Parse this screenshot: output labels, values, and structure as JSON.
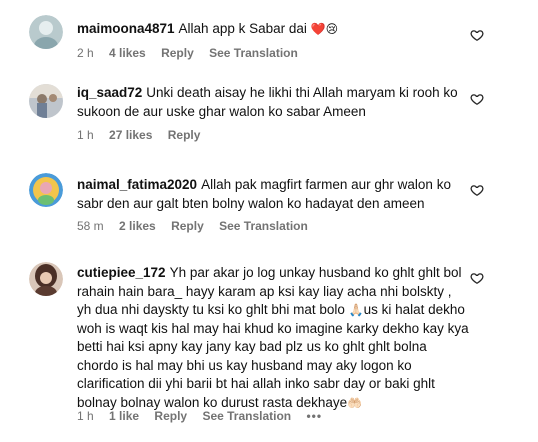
{
  "comments": [
    {
      "username": "maimoona4871",
      "text": "Allah app k Sabar dai",
      "emoji": "❤️😢",
      "time": "2 h",
      "likes": "4 likes",
      "reply": "Reply",
      "see_translation": "See Translation",
      "avatar_colors": [
        "#8aa6ad",
        "#dfe9ea"
      ]
    },
    {
      "username": "iq_saad72",
      "text": "Unki death aisay he likhi thi Allah maryam ki rooh ko sukoon de aur uske ghar walon ko sabar Ameen",
      "time": "1 h",
      "likes": "27 likes",
      "reply": "Reply",
      "avatar_colors": [
        "#c9c2b8",
        "#9a9fa6"
      ]
    },
    {
      "username": "naimal_fatima2020",
      "text": "Allah pak magfirt farmen aur ghr walon ko sabr den aur galt bten bolny walon ko hadayat den ameen",
      "time": "58 m",
      "likes": "2 likes",
      "reply": "Reply",
      "see_translation": "See Translation",
      "avatar_colors": [
        "#3d8fd6",
        "#f1c14d"
      ]
    },
    {
      "username": "cutiepiee_172",
      "text_before_emoji": "Yh par akar jo log unkay husband ko ghlt ghlt bol rahain hain bara_ hayy karam ap ksi kay liay acha nhi bolskty , yh dua nhi dayskty tu ksi ko ghlt bhi mat bolo ",
      "emoji_mid": "🙏🏻",
      "text_after_emoji": "us ki halat dekho woh is waqt kis hal may hai khud ko imagine karky dekho kay kya betti hai ksi apny kay jany kay bad plz us ko ghlt ghlt bolna chordo is hal may bhi us kay husband may aky logon ko clarification dii yhi barii bt hai allah inko sabr day or baki ghlt bolnay bolnay walon ko durust rasta dekhaye",
      "emoji_end": "🤲🏻",
      "time": "1 h",
      "likes": "1 like",
      "reply": "Reply",
      "see_translation": "See Translation",
      "more": "•••",
      "avatar_colors": [
        "#6b4a3d",
        "#d8c2b4"
      ]
    }
  ],
  "icons": {
    "like": "heart-outline-icon"
  },
  "colors": {
    "meta": "#737373",
    "text": "#111111"
  }
}
